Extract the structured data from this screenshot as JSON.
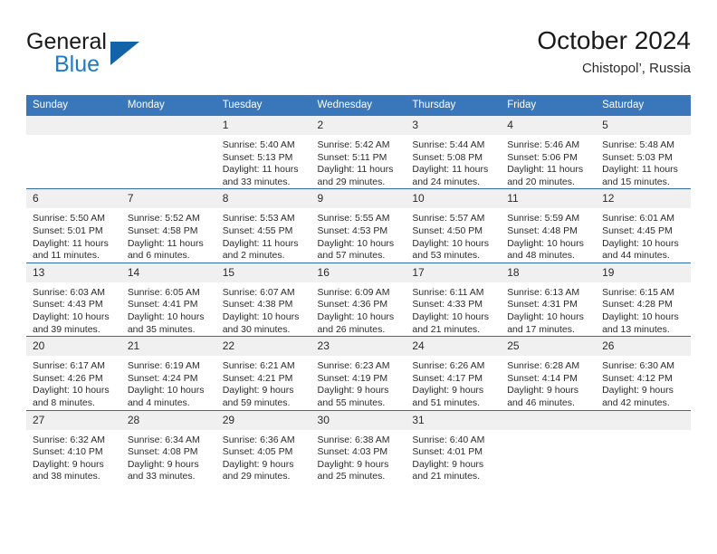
{
  "brand": {
    "name_part1": "General",
    "name_part2": "Blue",
    "triangle_color": "#1263a8",
    "blue_text_color": "#1f7bc4"
  },
  "header": {
    "title": "October 2024",
    "subtitle": "Chistopol’, Russia"
  },
  "theme": {
    "header_row_bg": "#3a77ba",
    "header_row_text": "#ffffff",
    "daynum_bg": "#f0f0f0",
    "row_divider": "#2f6cae"
  },
  "weekday_headers": [
    "Sunday",
    "Monday",
    "Tuesday",
    "Wednesday",
    "Thursday",
    "Friday",
    "Saturday"
  ],
  "weeks": [
    [
      {
        "day": "",
        "sunrise": "",
        "sunset": "",
        "daylight_line1": "",
        "daylight_line2": ""
      },
      {
        "day": "",
        "sunrise": "",
        "sunset": "",
        "daylight_line1": "",
        "daylight_line2": ""
      },
      {
        "day": "1",
        "sunrise": "Sunrise: 5:40 AM",
        "sunset": "Sunset: 5:13 PM",
        "daylight_line1": "Daylight: 11 hours",
        "daylight_line2": "and 33 minutes."
      },
      {
        "day": "2",
        "sunrise": "Sunrise: 5:42 AM",
        "sunset": "Sunset: 5:11 PM",
        "daylight_line1": "Daylight: 11 hours",
        "daylight_line2": "and 29 minutes."
      },
      {
        "day": "3",
        "sunrise": "Sunrise: 5:44 AM",
        "sunset": "Sunset: 5:08 PM",
        "daylight_line1": "Daylight: 11 hours",
        "daylight_line2": "and 24 minutes."
      },
      {
        "day": "4",
        "sunrise": "Sunrise: 5:46 AM",
        "sunset": "Sunset: 5:06 PM",
        "daylight_line1": "Daylight: 11 hours",
        "daylight_line2": "and 20 minutes."
      },
      {
        "day": "5",
        "sunrise": "Sunrise: 5:48 AM",
        "sunset": "Sunset: 5:03 PM",
        "daylight_line1": "Daylight: 11 hours",
        "daylight_line2": "and 15 minutes."
      }
    ],
    [
      {
        "day": "6",
        "sunrise": "Sunrise: 5:50 AM",
        "sunset": "Sunset: 5:01 PM",
        "daylight_line1": "Daylight: 11 hours",
        "daylight_line2": "and 11 minutes."
      },
      {
        "day": "7",
        "sunrise": "Sunrise: 5:52 AM",
        "sunset": "Sunset: 4:58 PM",
        "daylight_line1": "Daylight: 11 hours",
        "daylight_line2": "and 6 minutes."
      },
      {
        "day": "8",
        "sunrise": "Sunrise: 5:53 AM",
        "sunset": "Sunset: 4:55 PM",
        "daylight_line1": "Daylight: 11 hours",
        "daylight_line2": "and 2 minutes."
      },
      {
        "day": "9",
        "sunrise": "Sunrise: 5:55 AM",
        "sunset": "Sunset: 4:53 PM",
        "daylight_line1": "Daylight: 10 hours",
        "daylight_line2": "and 57 minutes."
      },
      {
        "day": "10",
        "sunrise": "Sunrise: 5:57 AM",
        "sunset": "Sunset: 4:50 PM",
        "daylight_line1": "Daylight: 10 hours",
        "daylight_line2": "and 53 minutes."
      },
      {
        "day": "11",
        "sunrise": "Sunrise: 5:59 AM",
        "sunset": "Sunset: 4:48 PM",
        "daylight_line1": "Daylight: 10 hours",
        "daylight_line2": "and 48 minutes."
      },
      {
        "day": "12",
        "sunrise": "Sunrise: 6:01 AM",
        "sunset": "Sunset: 4:45 PM",
        "daylight_line1": "Daylight: 10 hours",
        "daylight_line2": "and 44 minutes."
      }
    ],
    [
      {
        "day": "13",
        "sunrise": "Sunrise: 6:03 AM",
        "sunset": "Sunset: 4:43 PM",
        "daylight_line1": "Daylight: 10 hours",
        "daylight_line2": "and 39 minutes."
      },
      {
        "day": "14",
        "sunrise": "Sunrise: 6:05 AM",
        "sunset": "Sunset: 4:41 PM",
        "daylight_line1": "Daylight: 10 hours",
        "daylight_line2": "and 35 minutes."
      },
      {
        "day": "15",
        "sunrise": "Sunrise: 6:07 AM",
        "sunset": "Sunset: 4:38 PM",
        "daylight_line1": "Daylight: 10 hours",
        "daylight_line2": "and 30 minutes."
      },
      {
        "day": "16",
        "sunrise": "Sunrise: 6:09 AM",
        "sunset": "Sunset: 4:36 PM",
        "daylight_line1": "Daylight: 10 hours",
        "daylight_line2": "and 26 minutes."
      },
      {
        "day": "17",
        "sunrise": "Sunrise: 6:11 AM",
        "sunset": "Sunset: 4:33 PM",
        "daylight_line1": "Daylight: 10 hours",
        "daylight_line2": "and 21 minutes."
      },
      {
        "day": "18",
        "sunrise": "Sunrise: 6:13 AM",
        "sunset": "Sunset: 4:31 PM",
        "daylight_line1": "Daylight: 10 hours",
        "daylight_line2": "and 17 minutes."
      },
      {
        "day": "19",
        "sunrise": "Sunrise: 6:15 AM",
        "sunset": "Sunset: 4:28 PM",
        "daylight_line1": "Daylight: 10 hours",
        "daylight_line2": "and 13 minutes."
      }
    ],
    [
      {
        "day": "20",
        "sunrise": "Sunrise: 6:17 AM",
        "sunset": "Sunset: 4:26 PM",
        "daylight_line1": "Daylight: 10 hours",
        "daylight_line2": "and 8 minutes."
      },
      {
        "day": "21",
        "sunrise": "Sunrise: 6:19 AM",
        "sunset": "Sunset: 4:24 PM",
        "daylight_line1": "Daylight: 10 hours",
        "daylight_line2": "and 4 minutes."
      },
      {
        "day": "22",
        "sunrise": "Sunrise: 6:21 AM",
        "sunset": "Sunset: 4:21 PM",
        "daylight_line1": "Daylight: 9 hours",
        "daylight_line2": "and 59 minutes."
      },
      {
        "day": "23",
        "sunrise": "Sunrise: 6:23 AM",
        "sunset": "Sunset: 4:19 PM",
        "daylight_line1": "Daylight: 9 hours",
        "daylight_line2": "and 55 minutes."
      },
      {
        "day": "24",
        "sunrise": "Sunrise: 6:26 AM",
        "sunset": "Sunset: 4:17 PM",
        "daylight_line1": "Daylight: 9 hours",
        "daylight_line2": "and 51 minutes."
      },
      {
        "day": "25",
        "sunrise": "Sunrise: 6:28 AM",
        "sunset": "Sunset: 4:14 PM",
        "daylight_line1": "Daylight: 9 hours",
        "daylight_line2": "and 46 minutes."
      },
      {
        "day": "26",
        "sunrise": "Sunrise: 6:30 AM",
        "sunset": "Sunset: 4:12 PM",
        "daylight_line1": "Daylight: 9 hours",
        "daylight_line2": "and 42 minutes."
      }
    ],
    [
      {
        "day": "27",
        "sunrise": "Sunrise: 6:32 AM",
        "sunset": "Sunset: 4:10 PM",
        "daylight_line1": "Daylight: 9 hours",
        "daylight_line2": "and 38 minutes."
      },
      {
        "day": "28",
        "sunrise": "Sunrise: 6:34 AM",
        "sunset": "Sunset: 4:08 PM",
        "daylight_line1": "Daylight: 9 hours",
        "daylight_line2": "and 33 minutes."
      },
      {
        "day": "29",
        "sunrise": "Sunrise: 6:36 AM",
        "sunset": "Sunset: 4:05 PM",
        "daylight_line1": "Daylight: 9 hours",
        "daylight_line2": "and 29 minutes."
      },
      {
        "day": "30",
        "sunrise": "Sunrise: 6:38 AM",
        "sunset": "Sunset: 4:03 PM",
        "daylight_line1": "Daylight: 9 hours",
        "daylight_line2": "and 25 minutes."
      },
      {
        "day": "31",
        "sunrise": "Sunrise: 6:40 AM",
        "sunset": "Sunset: 4:01 PM",
        "daylight_line1": "Daylight: 9 hours",
        "daylight_line2": "and 21 minutes."
      },
      {
        "day": "",
        "sunrise": "",
        "sunset": "",
        "daylight_line1": "",
        "daylight_line2": ""
      },
      {
        "day": "",
        "sunrise": "",
        "sunset": "",
        "daylight_line1": "",
        "daylight_line2": ""
      }
    ]
  ]
}
